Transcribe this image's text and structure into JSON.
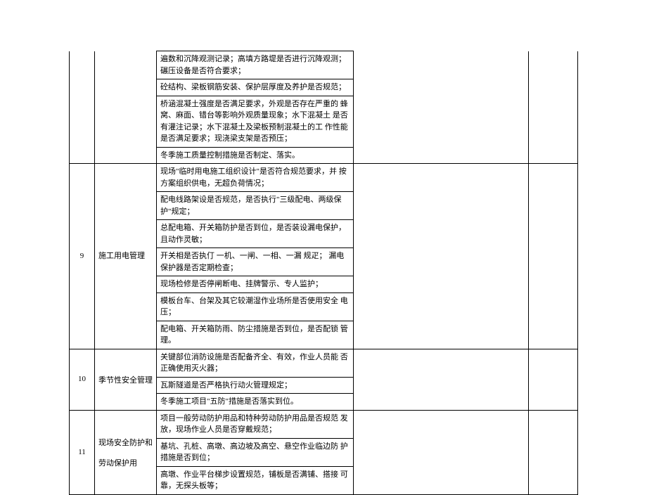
{
  "rows": [
    {
      "num": "",
      "cat": "",
      "contents": [
        "遍数和沉降观测记录；高填方路堤是否进行沉降观测； 碾压设备是否符合要求；",
        "砼结构、梁板钢筋安装、保护层厚度及养护是否规范；",
        "桥涵混凝土强度是否满足要求，外观是否存在严重的 蜂窝、麻面、错台等影响外观质量现象；水下混凝土 是否有灌注记录；水下混凝土及梁板预制混凝土的工 作性能是否满足要求；现浇梁支架是否预压；",
        "冬季施工质量控制措施是否制定、落实。"
      ],
      "empties": [
        "",
        ""
      ]
    },
    {
      "num": "9",
      "cat": "施工用电管理",
      "contents": [
        "现场\"临时用电施工组织设计\"是否符合规范要求，并 按方案组织供电，无超负荷情况；",
        "配电线路架设是否规范，是否执行\"三级配电、两级保护\"规定；",
        "总配电箱、开关箱防护是否到位，是否装设漏电保护， 且动作灵敏；",
        "开关相是否执仃 一机、一闸、一相、一漏 规疋； 漏电保护器是否定期检查；",
        "现场检修是否停闸断电、挂牌警示、专人监护；",
        "模板台车、台架及其它较潮湿作业场所是否使用安全 电压；",
        "配电箱、开关箱防雨、防尘措施是否到位，是否配锁 管理。"
      ],
      "empties": [
        "",
        ""
      ]
    },
    {
      "num": "10",
      "cat": "季节性安全管理",
      "contents": [
        "关键部位消防设施是否配备齐全、有效，作业人员能 否正确使用灭火器；",
        "瓦斯隧道是否严格执行动火管理规定；",
        "冬季施工项目\"五防\"措施是否落实到位。"
      ],
      "empties": [
        "",
        ""
      ]
    },
    {
      "num": "11",
      "cat": "现场安全防护和劳动保护用",
      "contents": [
        "项目一般劳动防护用品和特种劳动防护用品是否规范 发放，现场作业人员是否穿戴规范；",
        "基坑、孔桩、高墩、高边坡及高空、悬空作业临边防 护措施是否到位；",
        "高墩、作业平台梯步设置规范，铺板是否满铺、搭接 可靠，无探头板等；"
      ],
      "empties": [
        "",
        ""
      ]
    }
  ]
}
